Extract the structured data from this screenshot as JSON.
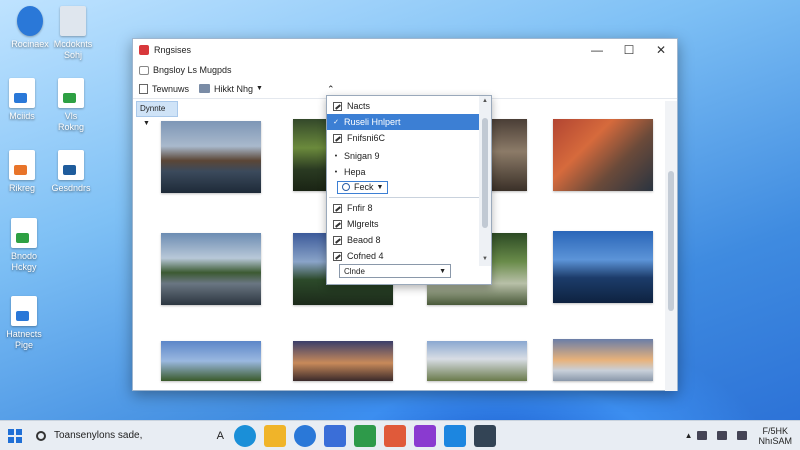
{
  "desktop": {
    "icons": [
      {
        "label_1": "Rocinaex",
        "label_2": ""
      },
      {
        "label_1": "Mcdoknts",
        "label_2": "Sohj"
      },
      {
        "label_1": "Mciids",
        "label_2": ""
      },
      {
        "label_1": "Vls",
        "label_2": "Rokng"
      },
      {
        "label_1": "Rikreg",
        "label_2": ""
      },
      {
        "label_1": "Gesdndrs",
        "label_2": ""
      },
      {
        "label_1": "Bnodo",
        "label_2": "Hckgy"
      },
      {
        "label_1": "Hatnects",
        "label_2": "Pige"
      }
    ]
  },
  "window": {
    "title": "Rngsises",
    "menu_label": "Bngsloy Ls Mugpds",
    "toolbar": {
      "item1": "Tewnuws",
      "item2": "Hikkt Nhg"
    },
    "sort_button": "Dynnte",
    "controls": {
      "minimize": "—",
      "maximize": "☐",
      "close": "✕"
    }
  },
  "dropdown": {
    "header": "Nacts",
    "selected_item": "Ruseli Hnlpert",
    "items": [
      {
        "label": "Fnifsni6C",
        "kind": "checkbox",
        "checked": true
      },
      {
        "label": "Snigan 9",
        "kind": "bullet",
        "checked": false
      },
      {
        "label": "Hepa",
        "kind": "bullet",
        "checked": false
      }
    ],
    "inline_select": "Feck",
    "options": [
      {
        "label": "Fnfir 8",
        "checked": true
      },
      {
        "label": "Mlgrelts",
        "checked": true
      },
      {
        "label": "Beaod 8",
        "checked": true
      },
      {
        "label": "Cofned 4",
        "checked": true
      }
    ],
    "select_value": "Clnde"
  },
  "taskbar": {
    "search_text": "Toansenylons sade,",
    "search_glyph": "A",
    "clock_line1": "F/5HK",
    "clock_line2": "NhıSAM"
  },
  "colors": {
    "accent": "#3c7fd4",
    "desktop_top": "#bfe3ff",
    "desktop_bottom": "#2a6fd6",
    "taskbar": "#e8edf3"
  }
}
